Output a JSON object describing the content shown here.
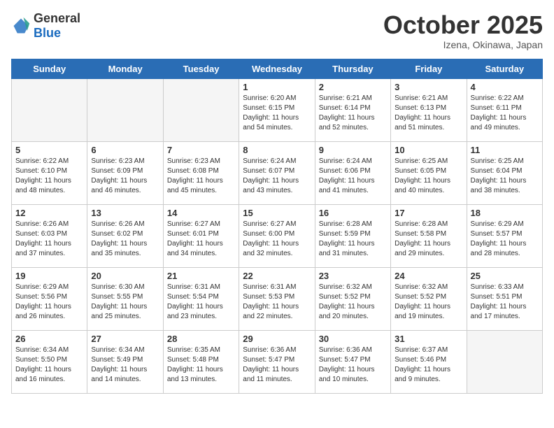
{
  "header": {
    "logo_general": "General",
    "logo_blue": "Blue",
    "month_title": "October 2025",
    "location": "Izena, Okinawa, Japan"
  },
  "weekdays": [
    "Sunday",
    "Monday",
    "Tuesday",
    "Wednesday",
    "Thursday",
    "Friday",
    "Saturday"
  ],
  "weeks": [
    [
      {
        "day": "",
        "empty": true
      },
      {
        "day": "",
        "empty": true
      },
      {
        "day": "",
        "empty": true
      },
      {
        "day": "1",
        "sunrise": "6:20 AM",
        "sunset": "6:15 PM",
        "daylight": "11 hours and 54 minutes."
      },
      {
        "day": "2",
        "sunrise": "6:21 AM",
        "sunset": "6:14 PM",
        "daylight": "11 hours and 52 minutes."
      },
      {
        "day": "3",
        "sunrise": "6:21 AM",
        "sunset": "6:13 PM",
        "daylight": "11 hours and 51 minutes."
      },
      {
        "day": "4",
        "sunrise": "6:22 AM",
        "sunset": "6:11 PM",
        "daylight": "11 hours and 49 minutes."
      }
    ],
    [
      {
        "day": "5",
        "sunrise": "6:22 AM",
        "sunset": "6:10 PM",
        "daylight": "11 hours and 48 minutes."
      },
      {
        "day": "6",
        "sunrise": "6:23 AM",
        "sunset": "6:09 PM",
        "daylight": "11 hours and 46 minutes."
      },
      {
        "day": "7",
        "sunrise": "6:23 AM",
        "sunset": "6:08 PM",
        "daylight": "11 hours and 45 minutes."
      },
      {
        "day": "8",
        "sunrise": "6:24 AM",
        "sunset": "6:07 PM",
        "daylight": "11 hours and 43 minutes."
      },
      {
        "day": "9",
        "sunrise": "6:24 AM",
        "sunset": "6:06 PM",
        "daylight": "11 hours and 41 minutes."
      },
      {
        "day": "10",
        "sunrise": "6:25 AM",
        "sunset": "6:05 PM",
        "daylight": "11 hours and 40 minutes."
      },
      {
        "day": "11",
        "sunrise": "6:25 AM",
        "sunset": "6:04 PM",
        "daylight": "11 hours and 38 minutes."
      }
    ],
    [
      {
        "day": "12",
        "sunrise": "6:26 AM",
        "sunset": "6:03 PM",
        "daylight": "11 hours and 37 minutes."
      },
      {
        "day": "13",
        "sunrise": "6:26 AM",
        "sunset": "6:02 PM",
        "daylight": "11 hours and 35 minutes."
      },
      {
        "day": "14",
        "sunrise": "6:27 AM",
        "sunset": "6:01 PM",
        "daylight": "11 hours and 34 minutes."
      },
      {
        "day": "15",
        "sunrise": "6:27 AM",
        "sunset": "6:00 PM",
        "daylight": "11 hours and 32 minutes."
      },
      {
        "day": "16",
        "sunrise": "6:28 AM",
        "sunset": "5:59 PM",
        "daylight": "11 hours and 31 minutes."
      },
      {
        "day": "17",
        "sunrise": "6:28 AM",
        "sunset": "5:58 PM",
        "daylight": "11 hours and 29 minutes."
      },
      {
        "day": "18",
        "sunrise": "6:29 AM",
        "sunset": "5:57 PM",
        "daylight": "11 hours and 28 minutes."
      }
    ],
    [
      {
        "day": "19",
        "sunrise": "6:29 AM",
        "sunset": "5:56 PM",
        "daylight": "11 hours and 26 minutes."
      },
      {
        "day": "20",
        "sunrise": "6:30 AM",
        "sunset": "5:55 PM",
        "daylight": "11 hours and 25 minutes."
      },
      {
        "day": "21",
        "sunrise": "6:31 AM",
        "sunset": "5:54 PM",
        "daylight": "11 hours and 23 minutes."
      },
      {
        "day": "22",
        "sunrise": "6:31 AM",
        "sunset": "5:53 PM",
        "daylight": "11 hours and 22 minutes."
      },
      {
        "day": "23",
        "sunrise": "6:32 AM",
        "sunset": "5:52 PM",
        "daylight": "11 hours and 20 minutes."
      },
      {
        "day": "24",
        "sunrise": "6:32 AM",
        "sunset": "5:52 PM",
        "daylight": "11 hours and 19 minutes."
      },
      {
        "day": "25",
        "sunrise": "6:33 AM",
        "sunset": "5:51 PM",
        "daylight": "11 hours and 17 minutes."
      }
    ],
    [
      {
        "day": "26",
        "sunrise": "6:34 AM",
        "sunset": "5:50 PM",
        "daylight": "11 hours and 16 minutes."
      },
      {
        "day": "27",
        "sunrise": "6:34 AM",
        "sunset": "5:49 PM",
        "daylight": "11 hours and 14 minutes."
      },
      {
        "day": "28",
        "sunrise": "6:35 AM",
        "sunset": "5:48 PM",
        "daylight": "11 hours and 13 minutes."
      },
      {
        "day": "29",
        "sunrise": "6:36 AM",
        "sunset": "5:47 PM",
        "daylight": "11 hours and 11 minutes."
      },
      {
        "day": "30",
        "sunrise": "6:36 AM",
        "sunset": "5:47 PM",
        "daylight": "11 hours and 10 minutes."
      },
      {
        "day": "31",
        "sunrise": "6:37 AM",
        "sunset": "5:46 PM",
        "daylight": "11 hours and 9 minutes."
      },
      {
        "day": "",
        "empty": true
      }
    ]
  ],
  "labels": {
    "sunrise": "Sunrise:",
    "sunset": "Sunset:",
    "daylight": "Daylight:"
  }
}
